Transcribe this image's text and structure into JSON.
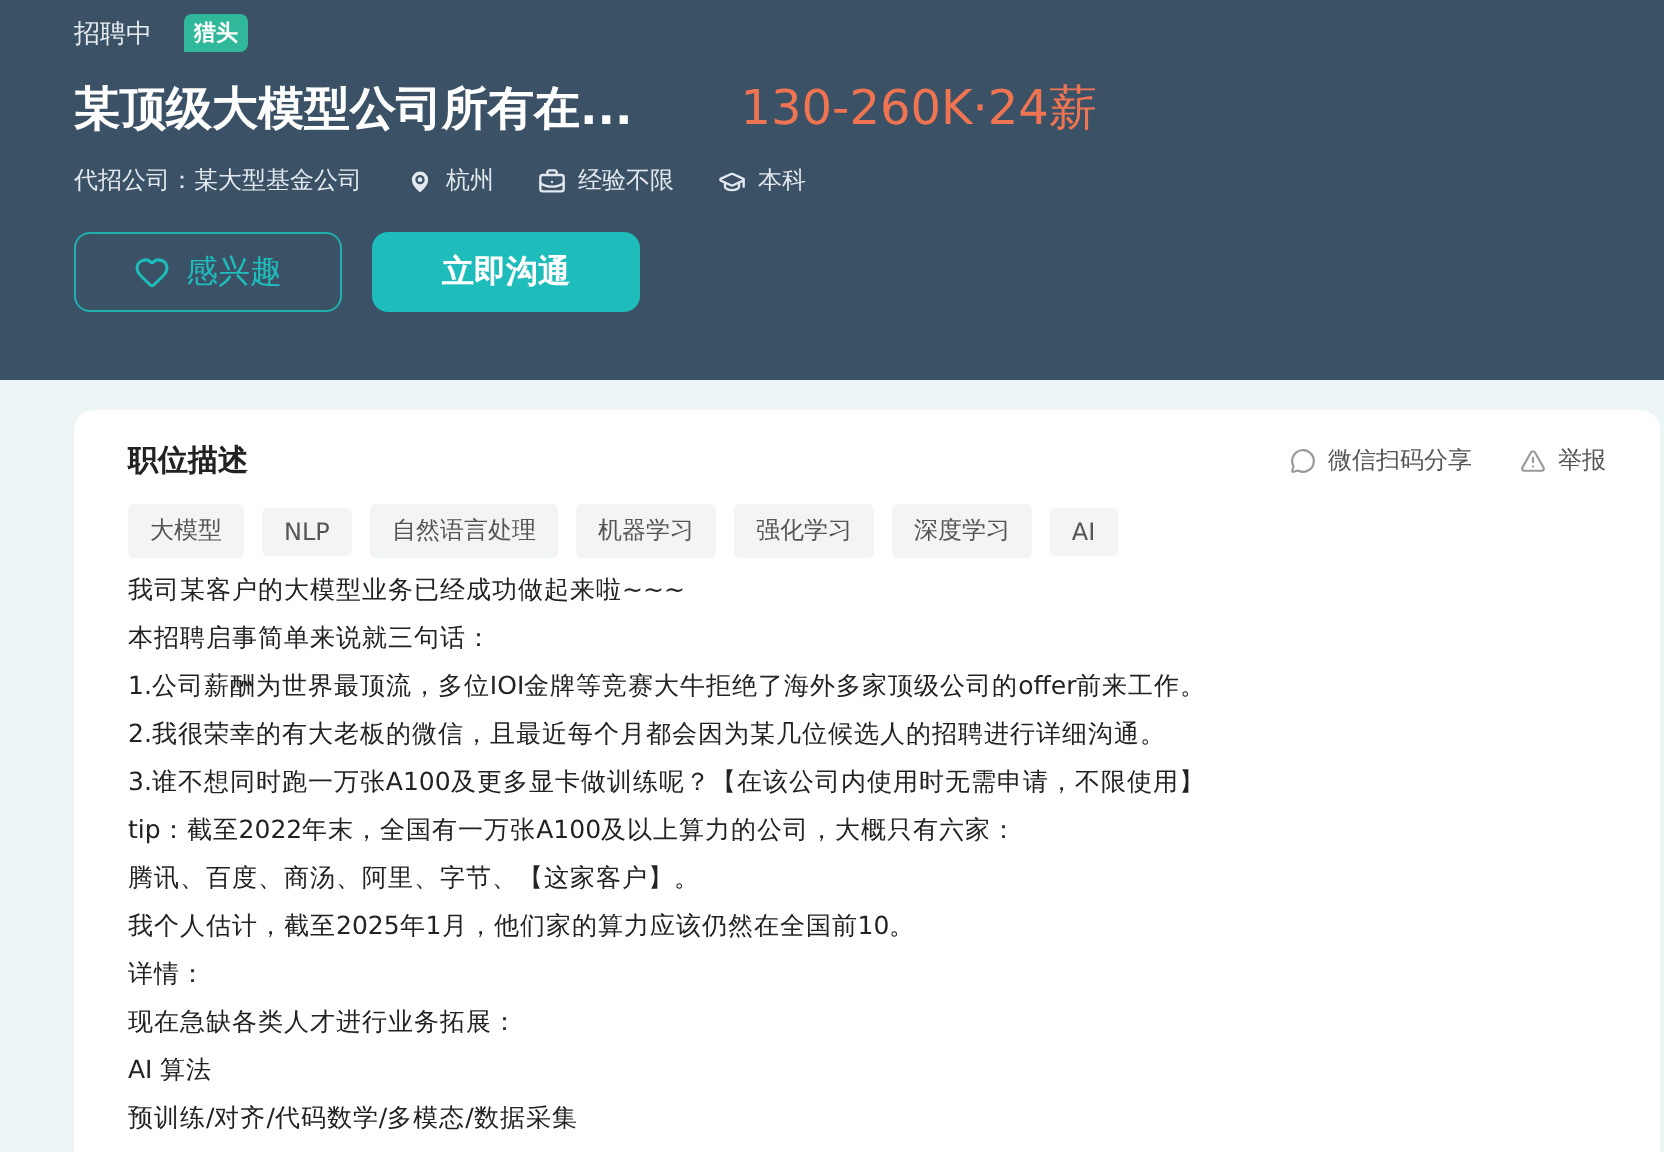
{
  "header": {
    "status": "招聘中",
    "badge": "猎头",
    "title": "某顶级大模型公司所有在...",
    "salary": "130-260K·24薪",
    "meta": [
      {
        "kind": "company",
        "text": "代招公司：某大型基金公司"
      },
      {
        "kind": "location",
        "text": "杭州"
      },
      {
        "kind": "experience",
        "text": "经验不限"
      },
      {
        "kind": "education",
        "text": "本科"
      }
    ],
    "buttons": [
      {
        "kind": "interest",
        "label": "感兴趣"
      },
      {
        "kind": "chat",
        "label": "立即沟通"
      }
    ]
  },
  "card": {
    "title": "职位描述",
    "actions": [
      {
        "kind": "share",
        "label": "微信扫码分享"
      },
      {
        "kind": "report",
        "label": "举报"
      }
    ],
    "tags": [
      "大模型",
      "NLP",
      "自然语言处理",
      "机器学习",
      "强化学习",
      "深度学习",
      "AI"
    ],
    "lines": [
      "我司某客户的大模型业务已经成功做起来啦~~~",
      "本招聘启事简单来说就三句话：",
      "1.公司薪酬为世界最顶流，多位IOI金牌等竞赛大牛拒绝了海外多家顶级公司的offer前来工作。",
      "2.我很荣幸的有大老板的微信，且最近每个月都会因为某几位候选人的招聘进行详细沟通。",
      "3.谁不想同时跑一万张A100及更多显卡做训练呢？【在该公司内使用时无需申请，不限使用】",
      "tip：截至2022年末，全国有一万张A100及以上算力的公司，大概只有六家：",
      "腾讯、百度、商汤、阿里、字节、【这家客户】。",
      "我个人估计，截至2025年1月，他们家的算力应该仍然在全国前10。",
      "详情：",
      "现在急缺各类人才进行业务拓展：",
      "AI 算法",
      "预训练/对齐/代码数学/多模态/数据采集"
    ]
  }
}
